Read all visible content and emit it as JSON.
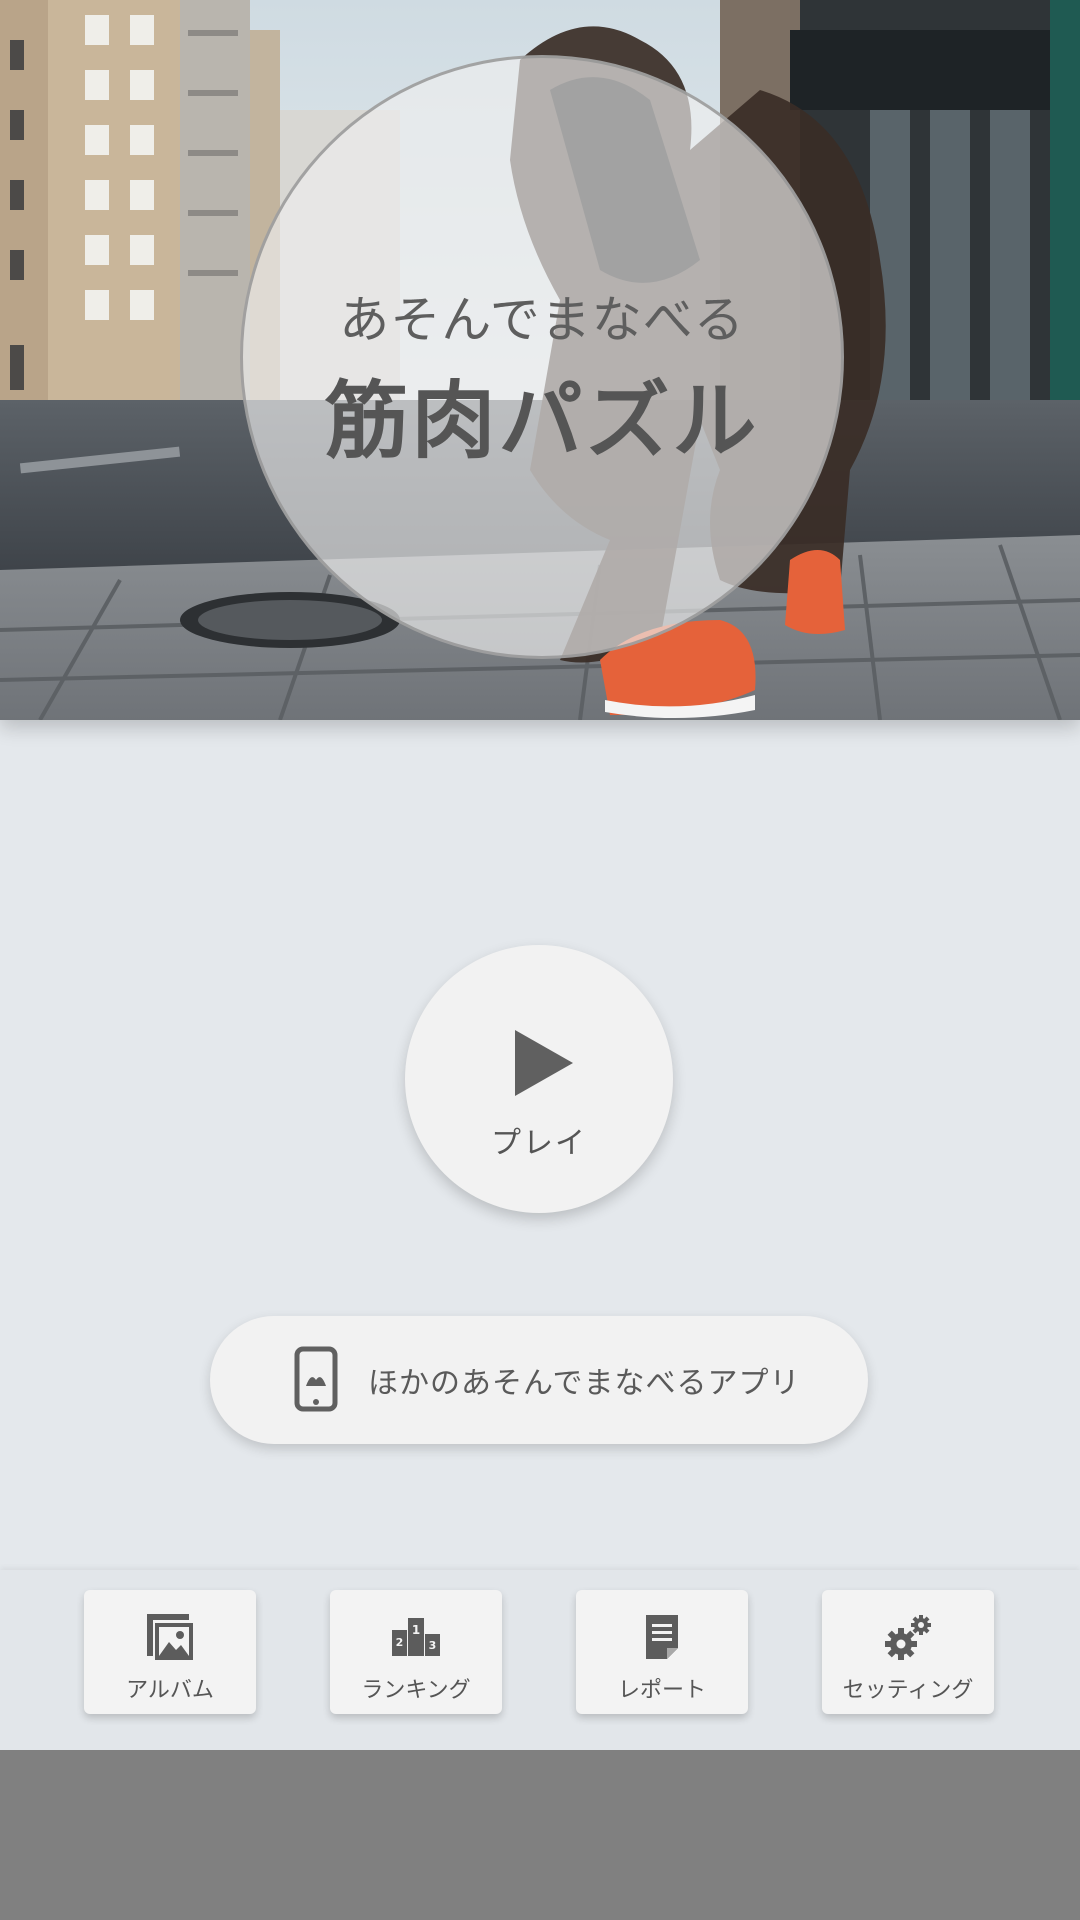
{
  "header": {
    "subtitle": "あそんでまなべる",
    "title": "筋肉パズル"
  },
  "play": {
    "label": "プレイ",
    "icon": "play-icon"
  },
  "other_apps": {
    "label": "ほかのあそんでまなべるアプリ",
    "icon": "smartphone-icon"
  },
  "nav": {
    "items": [
      {
        "label": "アルバム",
        "icon": "album-icon"
      },
      {
        "label": "ランキング",
        "icon": "podium-icon"
      },
      {
        "label": "レポート",
        "icon": "report-icon"
      },
      {
        "label": "セッティング",
        "icon": "gears-icon"
      }
    ]
  },
  "colors": {
    "background": "#e4e8ec",
    "button": "#f2f2f2",
    "icon": "#606060",
    "bottom_strip": "#808080"
  }
}
